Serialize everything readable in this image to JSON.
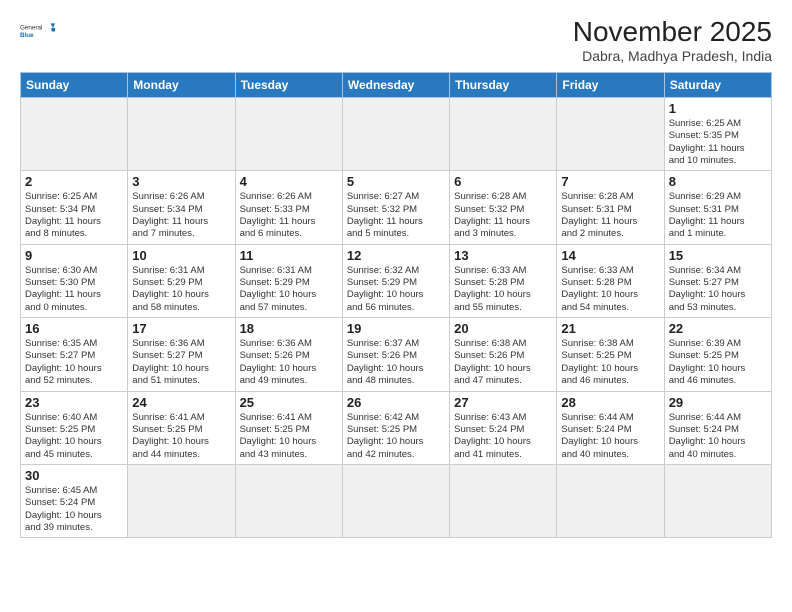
{
  "header": {
    "logo_general": "General",
    "logo_blue": "Blue",
    "month_title": "November 2025",
    "location": "Dabra, Madhya Pradesh, India"
  },
  "weekdays": [
    "Sunday",
    "Monday",
    "Tuesday",
    "Wednesday",
    "Thursday",
    "Friday",
    "Saturday"
  ],
  "days": {
    "1": "Sunrise: 6:25 AM\nSunset: 5:35 PM\nDaylight: 11 hours\nand 10 minutes.",
    "2": "Sunrise: 6:25 AM\nSunset: 5:34 PM\nDaylight: 11 hours\nand 8 minutes.",
    "3": "Sunrise: 6:26 AM\nSunset: 5:34 PM\nDaylight: 11 hours\nand 7 minutes.",
    "4": "Sunrise: 6:26 AM\nSunset: 5:33 PM\nDaylight: 11 hours\nand 6 minutes.",
    "5": "Sunrise: 6:27 AM\nSunset: 5:32 PM\nDaylight: 11 hours\nand 5 minutes.",
    "6": "Sunrise: 6:28 AM\nSunset: 5:32 PM\nDaylight: 11 hours\nand 3 minutes.",
    "7": "Sunrise: 6:28 AM\nSunset: 5:31 PM\nDaylight: 11 hours\nand 2 minutes.",
    "8": "Sunrise: 6:29 AM\nSunset: 5:31 PM\nDaylight: 11 hours\nand 1 minute.",
    "9": "Sunrise: 6:30 AM\nSunset: 5:30 PM\nDaylight: 11 hours\nand 0 minutes.",
    "10": "Sunrise: 6:31 AM\nSunset: 5:29 PM\nDaylight: 10 hours\nand 58 minutes.",
    "11": "Sunrise: 6:31 AM\nSunset: 5:29 PM\nDaylight: 10 hours\nand 57 minutes.",
    "12": "Sunrise: 6:32 AM\nSunset: 5:29 PM\nDaylight: 10 hours\nand 56 minutes.",
    "13": "Sunrise: 6:33 AM\nSunset: 5:28 PM\nDaylight: 10 hours\nand 55 minutes.",
    "14": "Sunrise: 6:33 AM\nSunset: 5:28 PM\nDaylight: 10 hours\nand 54 minutes.",
    "15": "Sunrise: 6:34 AM\nSunset: 5:27 PM\nDaylight: 10 hours\nand 53 minutes.",
    "16": "Sunrise: 6:35 AM\nSunset: 5:27 PM\nDaylight: 10 hours\nand 52 minutes.",
    "17": "Sunrise: 6:36 AM\nSunset: 5:27 PM\nDaylight: 10 hours\nand 51 minutes.",
    "18": "Sunrise: 6:36 AM\nSunset: 5:26 PM\nDaylight: 10 hours\nand 49 minutes.",
    "19": "Sunrise: 6:37 AM\nSunset: 5:26 PM\nDaylight: 10 hours\nand 48 minutes.",
    "20": "Sunrise: 6:38 AM\nSunset: 5:26 PM\nDaylight: 10 hours\nand 47 minutes.",
    "21": "Sunrise: 6:38 AM\nSunset: 5:25 PM\nDaylight: 10 hours\nand 46 minutes.",
    "22": "Sunrise: 6:39 AM\nSunset: 5:25 PM\nDaylight: 10 hours\nand 46 minutes.",
    "23": "Sunrise: 6:40 AM\nSunset: 5:25 PM\nDaylight: 10 hours\nand 45 minutes.",
    "24": "Sunrise: 6:41 AM\nSunset: 5:25 PM\nDaylight: 10 hours\nand 44 minutes.",
    "25": "Sunrise: 6:41 AM\nSunset: 5:25 PM\nDaylight: 10 hours\nand 43 minutes.",
    "26": "Sunrise: 6:42 AM\nSunset: 5:25 PM\nDaylight: 10 hours\nand 42 minutes.",
    "27": "Sunrise: 6:43 AM\nSunset: 5:24 PM\nDaylight: 10 hours\nand 41 minutes.",
    "28": "Sunrise: 6:44 AM\nSunset: 5:24 PM\nDaylight: 10 hours\nand 40 minutes.",
    "29": "Sunrise: 6:44 AM\nSunset: 5:24 PM\nDaylight: 10 hours\nand 40 minutes.",
    "30": "Sunrise: 6:45 AM\nSunset: 5:24 PM\nDaylight: 10 hours\nand 39 minutes."
  }
}
